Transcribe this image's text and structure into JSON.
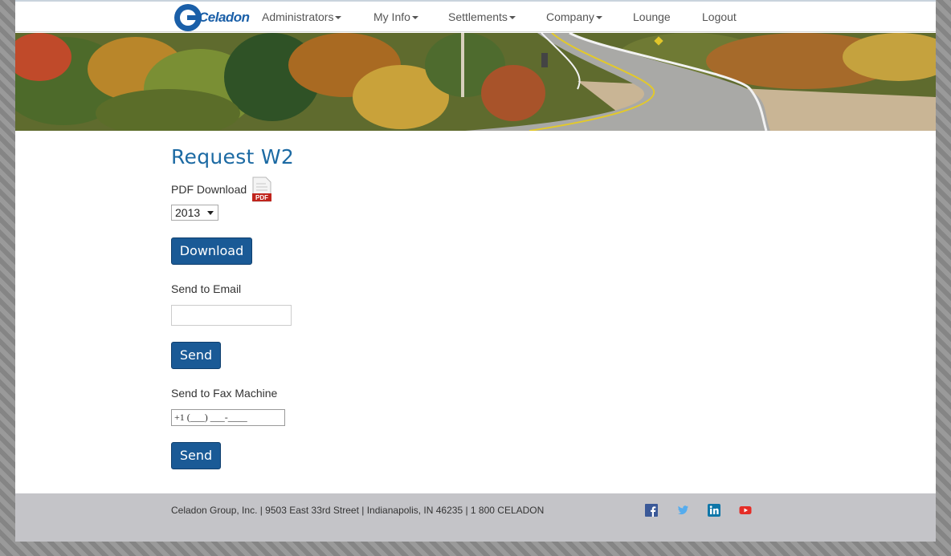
{
  "nav": {
    "logo_text": "Celadon",
    "items": [
      {
        "label": "Administrators",
        "dropdown": true
      },
      {
        "label": "My Info",
        "dropdown": true
      },
      {
        "label": "Settlements",
        "dropdown": true
      },
      {
        "label": "Company",
        "dropdown": true
      },
      {
        "label": "Lounge",
        "dropdown": false
      },
      {
        "label": "Logout",
        "dropdown": false
      }
    ]
  },
  "main": {
    "title": "Request W2",
    "pdf_label": "PDF Download",
    "pdf_icon_text": "PDF",
    "year_value": "2013",
    "download_button": "Download",
    "email_label": "Send to Email",
    "email_value": "",
    "send_email_button": "Send",
    "fax_label": "Send to Fax Machine",
    "fax_value": "+1 (___) ___-____",
    "send_fax_button": "Send"
  },
  "footer": {
    "text": "Celadon Group, Inc. | 9503 East 33rd Street | Indianapolis, IN 46235 | 1 800 CELADON",
    "social": [
      "facebook-icon",
      "twitter-icon",
      "linkedin-icon",
      "youtube-icon"
    ]
  },
  "colors": {
    "brand_blue": "#1a5fa8",
    "button_blue": "#1a5a96",
    "title_blue": "#1c6aa3",
    "footer_gray": "#c4c4c8"
  }
}
